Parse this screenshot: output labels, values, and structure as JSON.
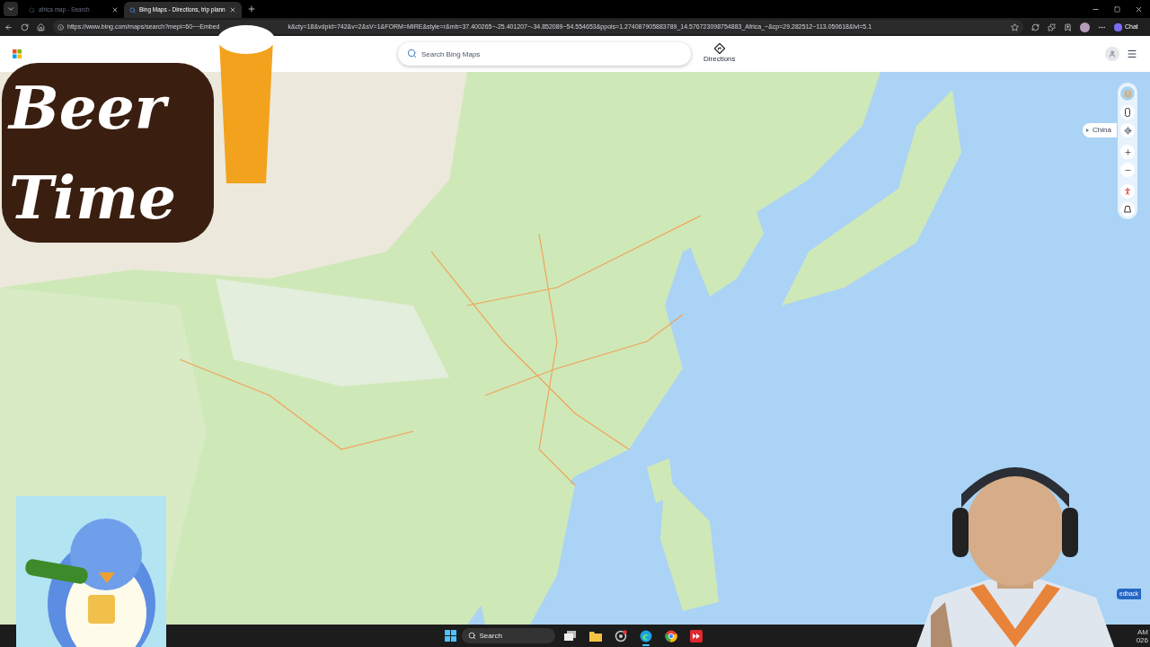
{
  "browser": {
    "tabs": [
      {
        "title": "africa map - Search",
        "selected": false
      },
      {
        "title": "Bing Maps - Directions, trip plann",
        "selected": true
      }
    ],
    "url_start": "https://www.bing.com/maps/search?mepi=60~~Embed",
    "url_end": "k&cty=18&vdpid=742&v=2&sV=1&FORM=MIRE&style=r&mb=37.400265~-25.401207~-34.852089~54.554653&ppois=1.274087905883789_14.576723098754883_Africa_~&cp=29.282512~113.050618&lvl=5.1",
    "chat_label": "Chat"
  },
  "overlay": {
    "title": "Beer Time"
  },
  "maps": {
    "search": {
      "placeholder": "Search Bing Maps"
    },
    "directions_label": "Directions",
    "location_pill": "China",
    "feedback_label": "edback"
  },
  "taskbar": {
    "search": {
      "placeholder": "Search"
    },
    "apps": [
      {
        "kind": "taskview",
        "selected": false
      },
      {
        "kind": "files",
        "selected": false
      },
      {
        "kind": "camera",
        "selected": false
      },
      {
        "kind": "edge",
        "selected": true
      },
      {
        "kind": "chrome",
        "selected": false
      },
      {
        "kind": "red",
        "selected": false
      }
    ],
    "clock_fragments": [
      "AM",
      "026"
    ]
  }
}
